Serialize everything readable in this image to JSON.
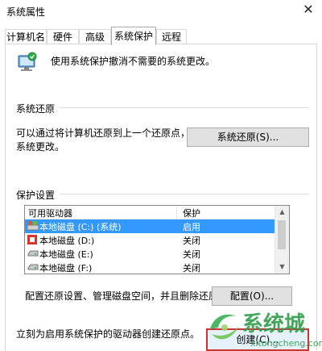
{
  "window": {
    "title": "系统属性",
    "close_glyph": "✕"
  },
  "tabs": [
    {
      "label": "计算机名"
    },
    {
      "label": "硬件"
    },
    {
      "label": "高级"
    },
    {
      "label": "系统保护",
      "active": true
    },
    {
      "label": "远程"
    }
  ],
  "intro": {
    "text": "使用系统保护撤消不需要的系统更改。",
    "icon": "system-protection-icon"
  },
  "restore": {
    "heading": "系统还原",
    "description_line1": "可以通过将计算机还原到上一个还原点，撤消",
    "description_line2": "系统更改。",
    "button_label": "系统还原(S)..."
  },
  "protection": {
    "heading": "保护设置",
    "columns": [
      "可用驱动器",
      "保护"
    ],
    "drives": [
      {
        "name": "本地磁盘 (C:) (系统)",
        "status": "启用",
        "icon": "system-drive-icon",
        "selected": true
      },
      {
        "name": "本地磁盘 (D:)",
        "status": "关闭",
        "icon": "colorful-drive-icon"
      },
      {
        "name": "本地磁盘 (E:)",
        "status": "关闭",
        "icon": "drive-icon"
      },
      {
        "name": "本地磁盘 (F:)",
        "status": "关闭",
        "icon": "drive-icon"
      }
    ],
    "configure_text": "配置还原设置、管理磁盘空间，并且删除还原点。",
    "configure_button": "配置(O)...",
    "create_text": "立刻为启用系统保护的驱动器创建还原点。",
    "create_button": "创建(C)..."
  },
  "watermark": {
    "brand": "系统城",
    "domain": "xitongcheng.com"
  },
  "colors": {
    "selection": "#3399ff",
    "accent_green": "#2eaa4a",
    "focus_border": "#cc3333"
  }
}
